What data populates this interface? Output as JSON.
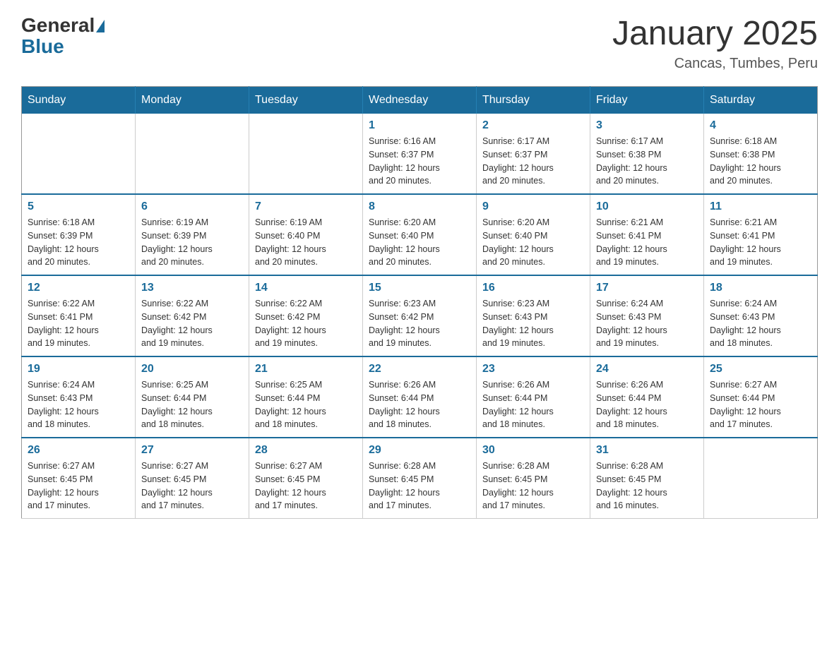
{
  "header": {
    "logo_general": "General",
    "logo_blue": "Blue",
    "month_title": "January 2025",
    "location": "Cancas, Tumbes, Peru"
  },
  "days_of_week": [
    "Sunday",
    "Monday",
    "Tuesday",
    "Wednesday",
    "Thursday",
    "Friday",
    "Saturday"
  ],
  "weeks": [
    [
      {
        "day": "",
        "info": ""
      },
      {
        "day": "",
        "info": ""
      },
      {
        "day": "",
        "info": ""
      },
      {
        "day": "1",
        "info": "Sunrise: 6:16 AM\nSunset: 6:37 PM\nDaylight: 12 hours\nand 20 minutes."
      },
      {
        "day": "2",
        "info": "Sunrise: 6:17 AM\nSunset: 6:37 PM\nDaylight: 12 hours\nand 20 minutes."
      },
      {
        "day": "3",
        "info": "Sunrise: 6:17 AM\nSunset: 6:38 PM\nDaylight: 12 hours\nand 20 minutes."
      },
      {
        "day": "4",
        "info": "Sunrise: 6:18 AM\nSunset: 6:38 PM\nDaylight: 12 hours\nand 20 minutes."
      }
    ],
    [
      {
        "day": "5",
        "info": "Sunrise: 6:18 AM\nSunset: 6:39 PM\nDaylight: 12 hours\nand 20 minutes."
      },
      {
        "day": "6",
        "info": "Sunrise: 6:19 AM\nSunset: 6:39 PM\nDaylight: 12 hours\nand 20 minutes."
      },
      {
        "day": "7",
        "info": "Sunrise: 6:19 AM\nSunset: 6:40 PM\nDaylight: 12 hours\nand 20 minutes."
      },
      {
        "day": "8",
        "info": "Sunrise: 6:20 AM\nSunset: 6:40 PM\nDaylight: 12 hours\nand 20 minutes."
      },
      {
        "day": "9",
        "info": "Sunrise: 6:20 AM\nSunset: 6:40 PM\nDaylight: 12 hours\nand 20 minutes."
      },
      {
        "day": "10",
        "info": "Sunrise: 6:21 AM\nSunset: 6:41 PM\nDaylight: 12 hours\nand 19 minutes."
      },
      {
        "day": "11",
        "info": "Sunrise: 6:21 AM\nSunset: 6:41 PM\nDaylight: 12 hours\nand 19 minutes."
      }
    ],
    [
      {
        "day": "12",
        "info": "Sunrise: 6:22 AM\nSunset: 6:41 PM\nDaylight: 12 hours\nand 19 minutes."
      },
      {
        "day": "13",
        "info": "Sunrise: 6:22 AM\nSunset: 6:42 PM\nDaylight: 12 hours\nand 19 minutes."
      },
      {
        "day": "14",
        "info": "Sunrise: 6:22 AM\nSunset: 6:42 PM\nDaylight: 12 hours\nand 19 minutes."
      },
      {
        "day": "15",
        "info": "Sunrise: 6:23 AM\nSunset: 6:42 PM\nDaylight: 12 hours\nand 19 minutes."
      },
      {
        "day": "16",
        "info": "Sunrise: 6:23 AM\nSunset: 6:43 PM\nDaylight: 12 hours\nand 19 minutes."
      },
      {
        "day": "17",
        "info": "Sunrise: 6:24 AM\nSunset: 6:43 PM\nDaylight: 12 hours\nand 19 minutes."
      },
      {
        "day": "18",
        "info": "Sunrise: 6:24 AM\nSunset: 6:43 PM\nDaylight: 12 hours\nand 18 minutes."
      }
    ],
    [
      {
        "day": "19",
        "info": "Sunrise: 6:24 AM\nSunset: 6:43 PM\nDaylight: 12 hours\nand 18 minutes."
      },
      {
        "day": "20",
        "info": "Sunrise: 6:25 AM\nSunset: 6:44 PM\nDaylight: 12 hours\nand 18 minutes."
      },
      {
        "day": "21",
        "info": "Sunrise: 6:25 AM\nSunset: 6:44 PM\nDaylight: 12 hours\nand 18 minutes."
      },
      {
        "day": "22",
        "info": "Sunrise: 6:26 AM\nSunset: 6:44 PM\nDaylight: 12 hours\nand 18 minutes."
      },
      {
        "day": "23",
        "info": "Sunrise: 6:26 AM\nSunset: 6:44 PM\nDaylight: 12 hours\nand 18 minutes."
      },
      {
        "day": "24",
        "info": "Sunrise: 6:26 AM\nSunset: 6:44 PM\nDaylight: 12 hours\nand 18 minutes."
      },
      {
        "day": "25",
        "info": "Sunrise: 6:27 AM\nSunset: 6:44 PM\nDaylight: 12 hours\nand 17 minutes."
      }
    ],
    [
      {
        "day": "26",
        "info": "Sunrise: 6:27 AM\nSunset: 6:45 PM\nDaylight: 12 hours\nand 17 minutes."
      },
      {
        "day": "27",
        "info": "Sunrise: 6:27 AM\nSunset: 6:45 PM\nDaylight: 12 hours\nand 17 minutes."
      },
      {
        "day": "28",
        "info": "Sunrise: 6:27 AM\nSunset: 6:45 PM\nDaylight: 12 hours\nand 17 minutes."
      },
      {
        "day": "29",
        "info": "Sunrise: 6:28 AM\nSunset: 6:45 PM\nDaylight: 12 hours\nand 17 minutes."
      },
      {
        "day": "30",
        "info": "Sunrise: 6:28 AM\nSunset: 6:45 PM\nDaylight: 12 hours\nand 17 minutes."
      },
      {
        "day": "31",
        "info": "Sunrise: 6:28 AM\nSunset: 6:45 PM\nDaylight: 12 hours\nand 16 minutes."
      },
      {
        "day": "",
        "info": ""
      }
    ]
  ]
}
